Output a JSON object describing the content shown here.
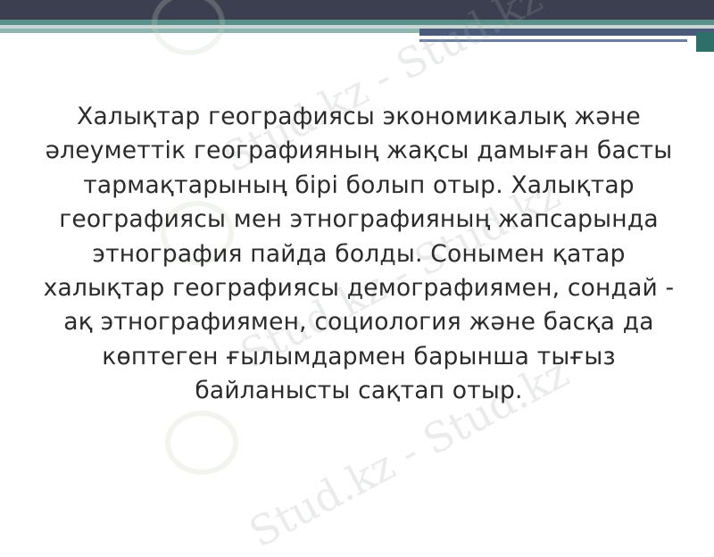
{
  "slide": {
    "paragraph": "Халықтар географиясы экономикалық және әлеуметтік географияның жақсы дамыған басты тармақтарының бірі болып отыр. Халықтар географиясы мен этнографияның жапсарында этнография пайда болды. Сонымен қатар халықтар географиясы демографиямен, сондай - ақ этнографиямен, социология және басқа да көптеген ғылымдармен барынша тығыз байланысты сақтап отыр."
  },
  "watermark": {
    "text": "Stud.kz - Stud.kz"
  },
  "colors": {
    "top_bar": "#3b3f4f",
    "accent_teal": "#5a8f8a",
    "accent_blue": "#4b5a78",
    "text": "#2b2b2b"
  }
}
